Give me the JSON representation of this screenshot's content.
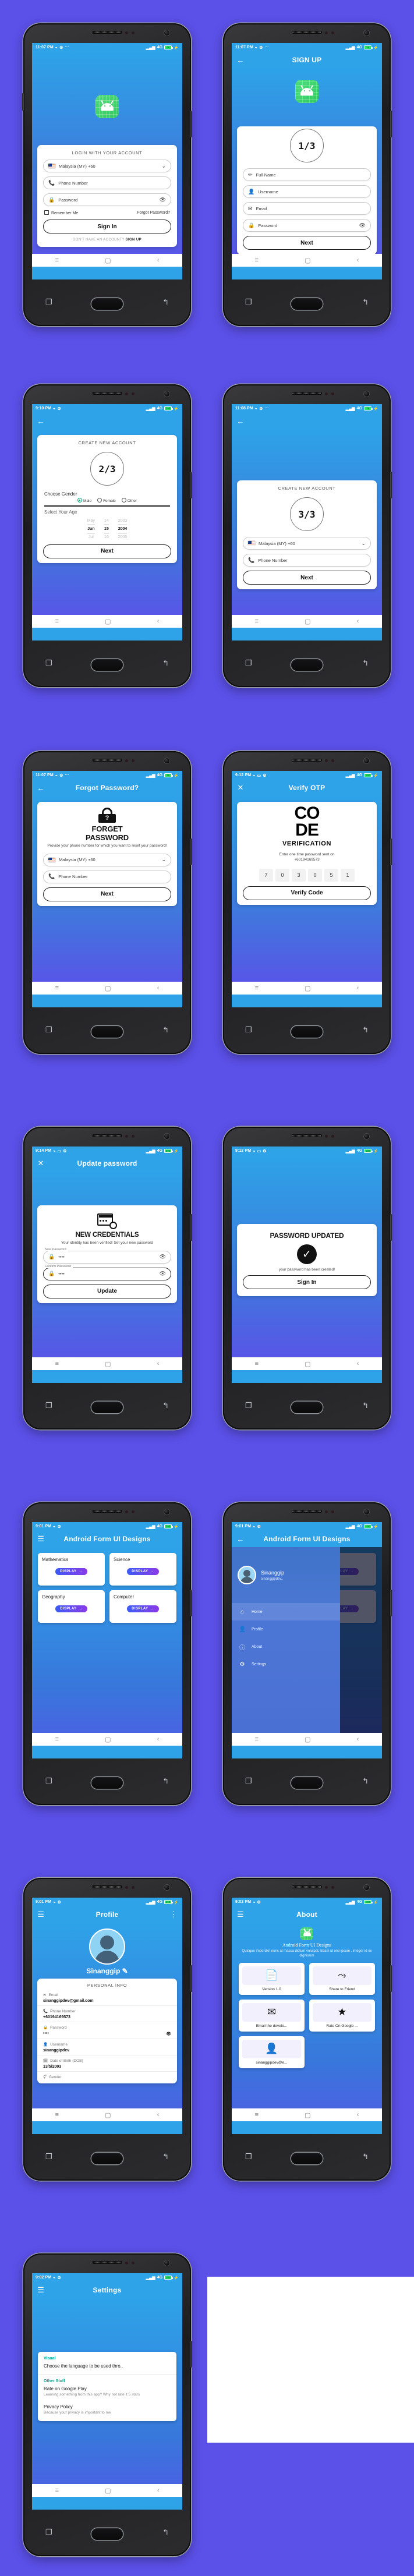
{
  "page": {
    "background": "#5B50E8",
    "accent": "#2EA3E8",
    "brand_green": "#31C95F"
  },
  "status_bars": {
    "t1107": "11:07 PM",
    "t1108": "11:08 PM",
    "t910": "9:10 PM",
    "t912": "9:12 PM",
    "t914": "9:14 PM",
    "t901": "9:01 PM",
    "t902": "9:02 PM",
    "network": "4G",
    "battery_76": "76",
    "battery_100": "100"
  },
  "login": {
    "card_title": "LOGIN WITH YOUR ACCOUNT",
    "country": "Malaysia (MY)  +60",
    "phone_placeholder": "Phone Number",
    "password_placeholder": "Password",
    "remember_me": "Remember Me",
    "forgot_password": "Forgot Password?",
    "sign_in": "Sign In",
    "footer_prefix": "DON'T HAVE AN ACCOUNT?",
    "footer_link": "SIGN UP"
  },
  "signup1": {
    "appbar_title": "SIGN UP",
    "step": "1/3",
    "fields": [
      {
        "label": "Full Name",
        "icon": "pencil-icon"
      },
      {
        "label": "Username",
        "icon": "person-icon"
      },
      {
        "label": "Email",
        "icon": "envelope-icon"
      },
      {
        "label": "Password",
        "icon": "lock-icon"
      }
    ],
    "next": "Next"
  },
  "signup2": {
    "card_title": "CREATE NEW ACCOUNT",
    "step": "2/3",
    "gender_label": "Choose Gender",
    "genders": [
      "Male",
      "Female",
      "Other"
    ],
    "gender_selected": "Male",
    "age_label": "Select Your Age",
    "picker": {
      "months": [
        "May",
        "Jun",
        "Jul"
      ],
      "days": [
        "14",
        "15",
        "16"
      ],
      "years": [
        "2003",
        "2004",
        "2005"
      ],
      "selected": {
        "month": "Jun",
        "day": "15",
        "year": "2004"
      }
    },
    "next": "Next"
  },
  "signup3": {
    "card_title": "CREATE NEW ACCOUNT",
    "step": "3/3",
    "country": "Malaysia (MY)  +60",
    "phone_placeholder": "Phone Number",
    "next": "Next"
  },
  "forgot": {
    "appbar_title": "Forgot Password?",
    "title_line1": "FORGET",
    "title_line2": "PASSWORD",
    "subtitle": "Provide your phone number for which you want to reset your password!",
    "country": "Malaysia (MY)  +60",
    "phone_placeholder": "Phone Number",
    "next": "Next"
  },
  "otp": {
    "appbar_title": "Verify OTP",
    "code_line1": "CO",
    "code_line2": "DE",
    "verification": "VERIFICATION",
    "hint_line1": "Enter one time password sent on",
    "hint_line2": "+60194169573",
    "digits": [
      "7",
      "0",
      "3",
      "0",
      "5",
      "1"
    ],
    "verify_button": "Verify Code"
  },
  "update": {
    "appbar_title": "Update password",
    "heading": "NEW CREDENTIALS",
    "subtitle": "Your identity has been verified! Set your new password",
    "new_password_label": "New Password",
    "new_password_value": "••••",
    "confirm_password_label": "Confirm Password",
    "confirm_password_value": "••••",
    "update_button": "Update"
  },
  "updated": {
    "heading": "PASSWORD UPDATED",
    "message": "your password has been created!",
    "sign_in": "Sign In"
  },
  "dashboard": {
    "appbar_title": "Android Form UI Designs",
    "subjects": [
      "Mathematics",
      "Science",
      "Geography",
      "Computer"
    ],
    "display_label": "DISPLAY"
  },
  "drawer": {
    "appbar_title": "Android Form UI Designs",
    "user_name": "Sinanggip",
    "user_email": "sinanggipdev..",
    "items": [
      {
        "label": "Home",
        "icon": "home-icon",
        "active": true
      },
      {
        "label": "Profile",
        "icon": "person-icon",
        "active": false
      },
      {
        "label": "About",
        "icon": "info-icon",
        "active": false
      },
      {
        "label": "Settings",
        "icon": "gear-icon",
        "active": false
      }
    ]
  },
  "profile": {
    "appbar_title": "Profile",
    "name": "Sinanggip",
    "section_title": "PERSONAL INFO",
    "rows": [
      {
        "key": "Email",
        "value": "sinanggipdev@gmail.com",
        "icon": "envelope-icon"
      },
      {
        "key": "Phone Number",
        "value": "+60194169573",
        "icon": "phone-icon"
      },
      {
        "key": "Password",
        "value": "••••",
        "icon": "lock-icon",
        "eye": true
      },
      {
        "key": "Username",
        "value": "sinanggipdev",
        "icon": "person-icon"
      },
      {
        "key": "Date of Birth (DOB)",
        "value": "13/5/2003",
        "icon": "calendar-icon"
      },
      {
        "key": "Gender",
        "value": "",
        "icon": "gender-icon"
      }
    ]
  },
  "about": {
    "appbar_title": "About",
    "app_name": "Android Form UI Designs",
    "description": "Quisque imperdiet nunc at massa dictum volutpat. Etiam id orci ipsum . integer id ex dignissim",
    "cards": [
      {
        "label": "Version 1.0",
        "icon": "document-icon"
      },
      {
        "label": "Share to Friend",
        "icon": "share-icon"
      },
      {
        "label": "Email the develo...",
        "icon": "envelope-icon"
      },
      {
        "label": "Rate On Google ...",
        "icon": "star-icon"
      },
      {
        "label": "sinanggipdev@e...",
        "icon": "person-icon"
      }
    ]
  },
  "settings": {
    "appbar_title": "Settings",
    "groups": [
      {
        "title": "Visual",
        "items": [
          {
            "title": "Choose the language to be used thro..",
            "subtitle": ""
          }
        ]
      },
      {
        "title": "Other Stuff",
        "items": [
          {
            "title": "Rate on Google Play",
            "subtitle": "Learning something from this app? Why not rate it 5 stars"
          },
          {
            "title": "Privacy Policy",
            "subtitle": "Because your privacy is important to me"
          }
        ]
      }
    ]
  }
}
